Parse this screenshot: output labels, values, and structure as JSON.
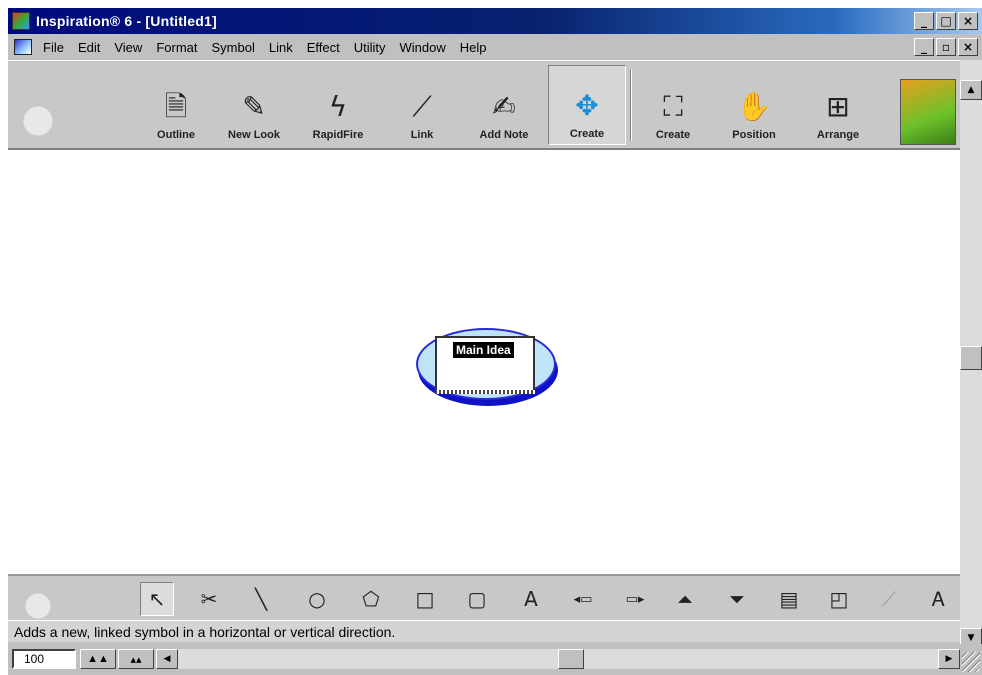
{
  "window": {
    "title": "Inspiration® 6 - [Untitled1]",
    "controls": {
      "minimize": "_",
      "maximize": "□",
      "close": "×"
    }
  },
  "menubar": {
    "items": [
      "File",
      "Edit",
      "View",
      "Format",
      "Symbol",
      "Link",
      "Effect",
      "Utility",
      "Window",
      "Help"
    ],
    "doc_controls": {
      "minimize": "_",
      "restore": "▫",
      "close": "×"
    }
  },
  "toolbar": {
    "tools": [
      {
        "label": "Outline",
        "icon": "outline-icon",
        "glyph": "🗎"
      },
      {
        "label": "New Look",
        "icon": "new-look-icon",
        "glyph": "✎"
      },
      {
        "label": "RapidFire",
        "icon": "rapidfire-icon",
        "glyph": "ϟ"
      },
      {
        "label": "Link",
        "icon": "link-icon",
        "glyph": "⟋"
      },
      {
        "label": "Add Note",
        "icon": "add-note-icon",
        "glyph": "✍"
      },
      {
        "label": "Create",
        "icon": "create-move-icon",
        "glyph": "✥",
        "pressed": true
      },
      {
        "label": "Create",
        "icon": "create-expand-icon",
        "glyph": "⛶"
      },
      {
        "label": "Position",
        "icon": "position-hand-icon",
        "glyph": "✋"
      },
      {
        "label": "Arrange",
        "icon": "arrange-icon",
        "glyph": "⊞"
      }
    ]
  },
  "canvas": {
    "main_idea_label": "Main Idea"
  },
  "drawing_tools": [
    {
      "name": "pointer-tool",
      "glyph": "↖",
      "pressed": true
    },
    {
      "name": "scissors-tool",
      "glyph": "✂"
    },
    {
      "name": "line-tool",
      "glyph": "╲"
    },
    {
      "name": "circle-tool",
      "glyph": "○"
    },
    {
      "name": "pentagon-tool",
      "glyph": "⬠"
    },
    {
      "name": "square-tool",
      "glyph": "□"
    },
    {
      "name": "rounded-square-tool",
      "glyph": "▢"
    },
    {
      "name": "text-tool",
      "glyph": "A"
    },
    {
      "name": "link-left-tool",
      "glyph": "◂▭"
    },
    {
      "name": "link-right-tool",
      "glyph": "▭▸"
    },
    {
      "name": "link-up-tool",
      "glyph": "⏶"
    },
    {
      "name": "link-down-tool",
      "glyph": "⏷"
    },
    {
      "name": "note-tool",
      "glyph": "▤"
    },
    {
      "name": "page-tool",
      "glyph": "◰"
    },
    {
      "name": "link-pen-tool",
      "glyph": "⟋"
    },
    {
      "name": "text-style-tool",
      "glyph": "Ꭺ"
    }
  ],
  "status": {
    "message": "Adds a new, linked symbol in a horizontal or vertical direction."
  },
  "bottom": {
    "zoom": "100"
  }
}
